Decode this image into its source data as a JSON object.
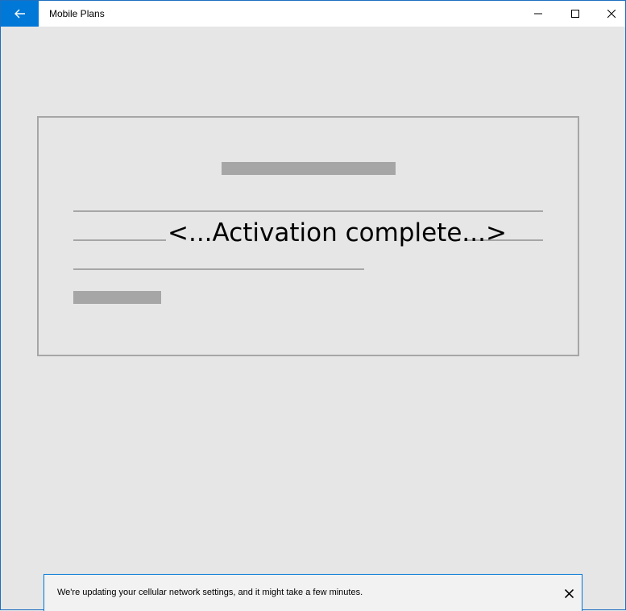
{
  "window": {
    "title": "Mobile Plans",
    "back_icon": "arrow-left-icon",
    "controls": [
      "minimize-icon",
      "maximize-icon",
      "close-icon"
    ],
    "accent": "#0078d7"
  },
  "card": {
    "activation_text": "<...Activation complete...>"
  },
  "notification": {
    "message": "We're updating your cellular network settings, and it might take a few minutes.",
    "close_icon": "close-icon"
  }
}
